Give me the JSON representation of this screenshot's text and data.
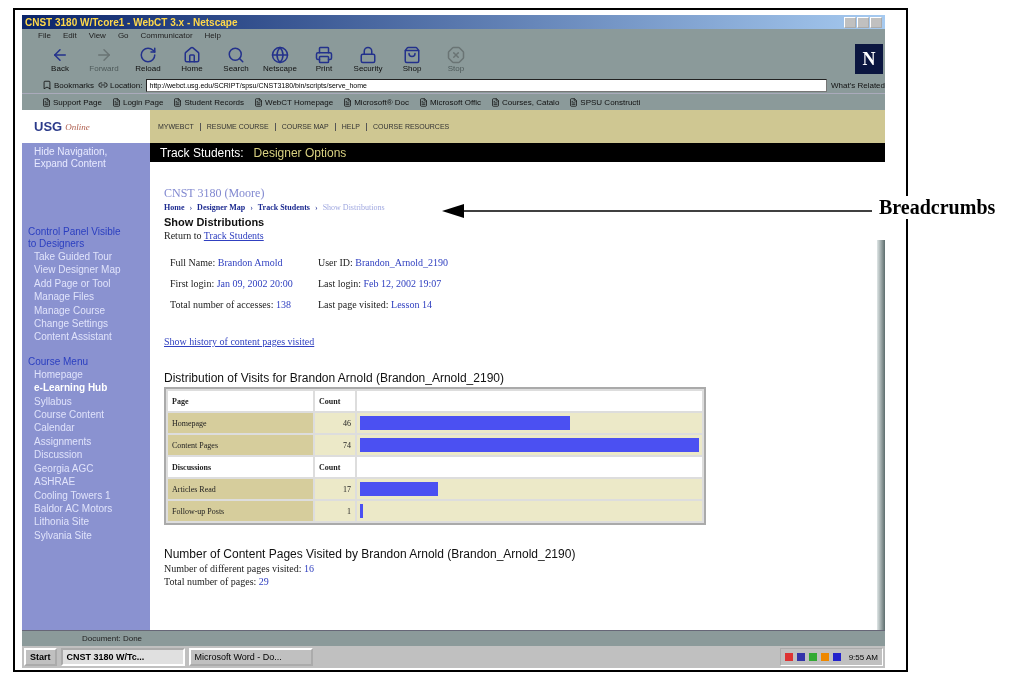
{
  "window": {
    "title": "CNST 3180 W/Tcore1 - WebCT 3.x - Netscape"
  },
  "menu": [
    "File",
    "Edit",
    "View",
    "Go",
    "Communicator",
    "Help"
  ],
  "toolbar": [
    {
      "kind": "back",
      "label": "Back",
      "disabled": false
    },
    {
      "kind": "forward",
      "label": "Forward",
      "disabled": true
    },
    {
      "kind": "reload",
      "label": "Reload",
      "disabled": false
    },
    {
      "kind": "home",
      "label": "Home",
      "disabled": false
    },
    {
      "kind": "search",
      "label": "Search",
      "disabled": false
    },
    {
      "kind": "netscape",
      "label": "Netscape",
      "disabled": false
    },
    {
      "kind": "print",
      "label": "Print",
      "disabled": false
    },
    {
      "kind": "security",
      "label": "Security",
      "disabled": false
    },
    {
      "kind": "shop",
      "label": "Shop",
      "disabled": false
    },
    {
      "kind": "stop",
      "label": "Stop",
      "disabled": true
    }
  ],
  "brand_logo": "N",
  "location_bar": {
    "bookmarks": "Bookmarks",
    "label": "Location:",
    "url": "http://webct.usg.edu/SCRIPT/spsu/CNST3180/bin/scripts/serve_home",
    "related": "What's Related"
  },
  "personal_toolbar": [
    "Support Page",
    "Login Page",
    "Student Records",
    "WebCT Homepage",
    "Microsoft® Doc",
    "Microsoft Offic",
    "Courses, Catalo",
    "SPSU Constructi"
  ],
  "course_logo": {
    "text": "USG",
    "subtext": "Online"
  },
  "top_nav": [
    "MYWEBCT",
    "RESUME COURSE",
    "COURSE MAP",
    "HELP",
    "COURSE RESOURCES"
  ],
  "page_banner": {
    "title": "Track Students:",
    "subtitle": "Designer Options"
  },
  "sidebar": {
    "toggle": "Hide Navigation, Expand Content",
    "sections": [
      {
        "title": "Control Panel Visible to Designers",
        "items": [
          {
            "label": "Take Guided Tour",
            "selected": false
          },
          {
            "label": "View Designer Map",
            "selected": false
          },
          {
            "label": "Add Page or Tool",
            "selected": false
          },
          {
            "label": "Manage Files",
            "selected": false
          },
          {
            "label": "Manage Course",
            "selected": false
          },
          {
            "label": "Change Settings",
            "selected": false
          },
          {
            "label": "Content Assistant",
            "selected": false
          }
        ]
      },
      {
        "title": "Course Menu",
        "items": [
          {
            "label": "Homepage",
            "selected": false
          },
          {
            "label": "e-Learning Hub",
            "selected": true
          },
          {
            "label": "Syllabus",
            "selected": false
          },
          {
            "label": "Course Content",
            "selected": false
          },
          {
            "label": "Calendar",
            "selected": false
          },
          {
            "label": "Assignments",
            "selected": false
          },
          {
            "label": "Discussion",
            "selected": false
          },
          {
            "label": "Georgia AGC",
            "selected": false
          },
          {
            "label": "ASHRAE",
            "selected": false
          },
          {
            "label": "Cooling Towers 1",
            "selected": false
          },
          {
            "label": "Baldor AC Motors",
            "selected": false
          },
          {
            "label": "Lithonia Site",
            "selected": false
          },
          {
            "label": "Sylvania Site",
            "selected": false
          }
        ]
      }
    ]
  },
  "content": {
    "course_title": "CNST 3180 (Moore)",
    "breadcrumbs": [
      {
        "label": "Home",
        "current": false
      },
      {
        "label": "Designer Map",
        "current": false
      },
      {
        "label": "Track Students",
        "current": false
      },
      {
        "label": "Show Distributions",
        "current": true
      }
    ],
    "breadcrumb_separator": "›",
    "heading": "Show Distributions",
    "return_text": "Return to",
    "return_link": "Track Students",
    "info": [
      {
        "label": "Full Name:",
        "value": "Brandon Arnold"
      },
      {
        "label": "User ID:",
        "value": "Brandon_Arnold_2190"
      },
      {
        "label": "First login:",
        "value": "Jan 09, 2002 20:00"
      },
      {
        "label": "Last login:",
        "value": "Feb 12, 2002 19:07"
      },
      {
        "label": "Total number of accesses:",
        "value": "138"
      },
      {
        "label": "Last page visited:",
        "value": "Lesson 14"
      }
    ],
    "history_link": "Show history of content pages visited",
    "distribution_title": "Distribution of Visits for Brandon Arnold (Brandon_Arnold_2190)",
    "distribution": [
      {
        "kind": "header",
        "label": "Page",
        "count": "Count"
      },
      {
        "kind": "row",
        "label": "Homepage",
        "count": "46",
        "level": 0.62
      },
      {
        "kind": "row",
        "label": "Content Pages",
        "count": "74",
        "level": 1
      },
      {
        "kind": "header",
        "label": "Discussions",
        "count": "Count"
      },
      {
        "kind": "row",
        "label": "Articles Read",
        "count": "17",
        "level": 0.23
      },
      {
        "kind": "row",
        "label": "Follow-up Posts",
        "count": "1",
        "level": 0.01
      }
    ],
    "pages_title": "Number of Content Pages Visited by Brandon Arnold (Brandon_Arnold_2190)",
    "pages_stats": [
      {
        "label": "Number of different pages visited:",
        "value": "16"
      },
      {
        "label": "Total number of pages:",
        "value": "29"
      }
    ]
  },
  "status_bar": "Document: Done",
  "taskbar": {
    "start": "Start",
    "tasks": [
      {
        "label": "CNST 3180 W/Tc...",
        "selected": true
      },
      {
        "label": "Microsoft Word - Do...",
        "selected": false
      }
    ],
    "clock": "9:55 AM"
  },
  "callout": "Breadcrumbs"
}
